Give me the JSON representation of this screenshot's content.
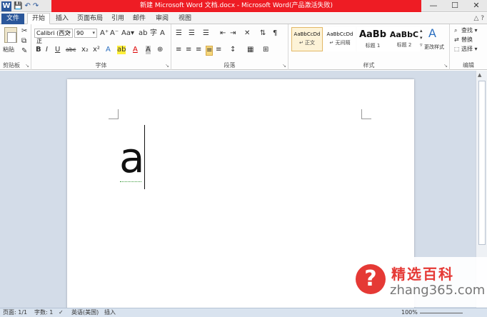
{
  "window": {
    "title": "新建 Microsoft Word 文档.docx - Microsoft Word(产品激活失败)",
    "controls": {
      "minimize": "—",
      "maximize": "☐",
      "close": "✕"
    }
  },
  "quick_access": {
    "logo": "W",
    "save": "💾",
    "undo": "↶",
    "redo": "↷"
  },
  "tabs": {
    "file": "文件",
    "items": [
      "开始",
      "插入",
      "页面布局",
      "引用",
      "邮件",
      "审阅",
      "视图"
    ],
    "active": "开始",
    "help": "△ ?"
  },
  "ribbon": {
    "clipboard": {
      "paste": "粘贴",
      "group": "剪贴板"
    },
    "font": {
      "font_name": "Calibri (西文正",
      "font_size": "90",
      "group": "字体",
      "row1": [
        "A⁺",
        "A⁻",
        "Aa▾",
        "ab",
        "字",
        "A"
      ],
      "row2": [
        "B",
        "I",
        "U",
        "abc",
        "x₂",
        "x²",
        "A",
        "ab",
        "A",
        "A",
        "⊕"
      ]
    },
    "paragraph": {
      "group": "段落"
    },
    "styles": {
      "group": "样式",
      "items": [
        {
          "preview": "AaBbCcDd",
          "name": "↵ 正文"
        },
        {
          "preview": "AaBbCcDd",
          "name": "↵ 无间隔"
        },
        {
          "preview": "AaBb",
          "name": "标题 1"
        },
        {
          "preview": "AaBbC",
          "name": "标题 2"
        }
      ],
      "change_styles": "更改样式"
    },
    "editing": {
      "group": "编辑",
      "find": "查找 ▾",
      "replace": "替换",
      "select": "选择 ▾"
    }
  },
  "document": {
    "text": "a"
  },
  "status": {
    "page": "页面: 1/1",
    "words": "字数: 1",
    "language": "英语(美国)",
    "mode": "插入",
    "zoom": "100%"
  },
  "watermark": {
    "symbol": "?",
    "brand": "精选百科",
    "site": "zhang365.com"
  }
}
